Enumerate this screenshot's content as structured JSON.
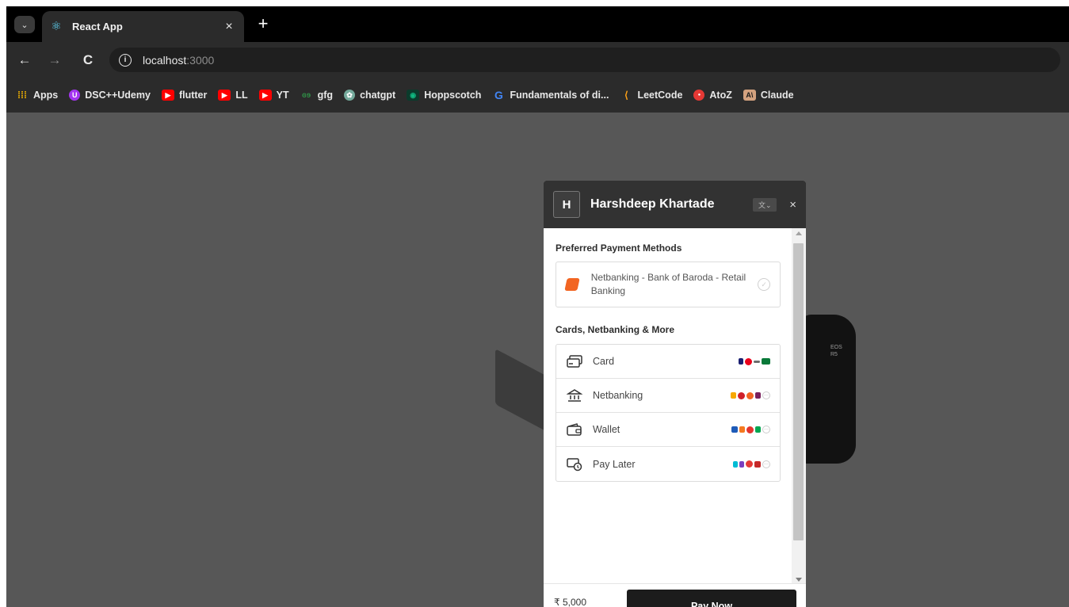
{
  "browser": {
    "tab": {
      "title": "React App",
      "icon": "react-icon",
      "close": "×"
    },
    "new_tab": "+",
    "tab_dropdown": "⌄",
    "nav": {
      "back": "←",
      "forward": "→",
      "reload": "C"
    },
    "url": {
      "host": "localhost",
      "port": ":3000"
    },
    "bookmarks": [
      {
        "label": "Apps",
        "icon": "apps-grid-icon",
        "color": "#f4b400"
      },
      {
        "label": "DSC++Udemy",
        "icon": "udemy-icon",
        "color": "#a435f0"
      },
      {
        "label": "flutter",
        "icon": "youtube-icon",
        "color": "#ff0000"
      },
      {
        "label": "LL",
        "icon": "youtube-icon",
        "color": "#ff0000"
      },
      {
        "label": "YT",
        "icon": "youtube-icon",
        "color": "#ff0000"
      },
      {
        "label": "gfg",
        "icon": "gfg-icon",
        "color": "#2f8d46"
      },
      {
        "label": "chatgpt",
        "icon": "chatgpt-icon",
        "color": "#74aa9c"
      },
      {
        "label": "Hoppscotch",
        "icon": "hoppscotch-icon",
        "color": "#10b981"
      },
      {
        "label": "Fundamentals of di...",
        "icon": "google-icon",
        "color": "#4285f4"
      },
      {
        "label": "LeetCode",
        "icon": "leetcode-icon",
        "color": "#ffa116"
      },
      {
        "label": "AtoZ",
        "icon": "atoz-icon",
        "color": "#e53935"
      },
      {
        "label": "Claude",
        "icon": "claude-icon",
        "color": "#d4a27f"
      }
    ]
  },
  "page": {
    "background": "#575757",
    "camera_text_line1": "EOS",
    "camera_text_line2": "R5"
  },
  "checkout": {
    "merchant_initial": "H",
    "merchant_name": "Harshdeep Khartade",
    "close": "×",
    "preferred_title": "Preferred Payment Methods",
    "preferred_method": "Netbanking - Bank of Baroda - Retail Banking",
    "more_title": "Cards, Netbanking & More",
    "methods": [
      {
        "label": "Card",
        "icon": "card-icon"
      },
      {
        "label": "Netbanking",
        "icon": "bank-icon"
      },
      {
        "label": "Wallet",
        "icon": "wallet-icon"
      },
      {
        "label": "Pay Later",
        "icon": "pay-later-icon"
      }
    ],
    "amount": "₹ 5,000",
    "pay_button": "Pay Now",
    "colors": {
      "header": "#323232",
      "accent_bob": "#f26522",
      "pay_button": "#1c1c1c"
    }
  }
}
